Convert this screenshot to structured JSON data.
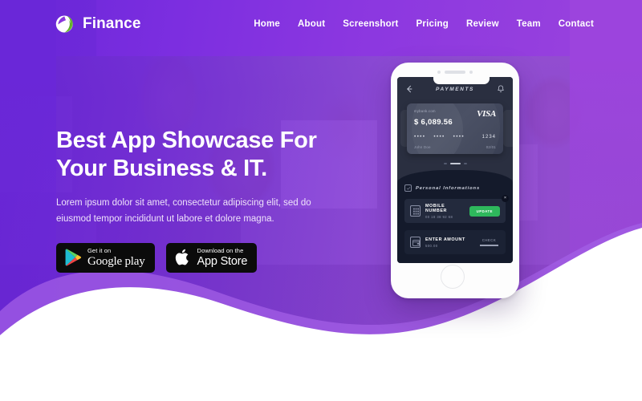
{
  "brand": {
    "name": "Finance",
    "icon": "finance-leaf-logo"
  },
  "nav": {
    "items": [
      {
        "label": "Home"
      },
      {
        "label": "About"
      },
      {
        "label": "Screenshort"
      },
      {
        "label": "Pricing"
      },
      {
        "label": "Review"
      },
      {
        "label": "Team"
      },
      {
        "label": "Contact"
      }
    ]
  },
  "hero": {
    "title_line1": "Best App Showcase For",
    "title_line2": "Your Business & IT.",
    "subtitle": "Lorem ipsum dolor sit amet, consectetur adipiscing elit, sed do eiusmod tempor incididunt ut labore et dolore magna.",
    "google_play": {
      "small": "Get it on",
      "big": "Google play",
      "icon": "google-play-icon"
    },
    "app_store": {
      "small": "Download on the",
      "big": "App Store",
      "icon": "apple-icon"
    }
  },
  "phone": {
    "screen": {
      "header": {
        "back_icon": "back-arrow-icon",
        "title": "PAYMENTS",
        "bell_icon": "bell-icon"
      },
      "card": {
        "bank": "mybank.com",
        "brand": "VISA",
        "amount": "$ 6,089.56",
        "group1": "••••",
        "group2": "••••",
        "group3": "••••",
        "last4": "1234",
        "holder": "John Doe",
        "expiry": "02/01"
      },
      "section": {
        "icon": "info-square-icon",
        "title": "Personal Informations"
      },
      "rows": [
        {
          "icon": "phone-keypad-icon",
          "label": "MOBILE NUMBER",
          "value": "00 18 38 92 68",
          "action": "UPDATE",
          "action_style": "green",
          "close": "×"
        },
        {
          "icon": "wallet-icon",
          "label": "ENTER AMOUNT",
          "value": "500.00",
          "action": "CHECK",
          "action_style": "ghost"
        }
      ]
    }
  },
  "colors": {
    "purple_dark": "#6a27d8",
    "purple_light": "#9c44dd",
    "wave_front": "#6f27d6",
    "wave_back": "#9b4ce0",
    "green": "#2eb85c",
    "screen_dark": "#141a2b",
    "white": "#ffffff"
  }
}
